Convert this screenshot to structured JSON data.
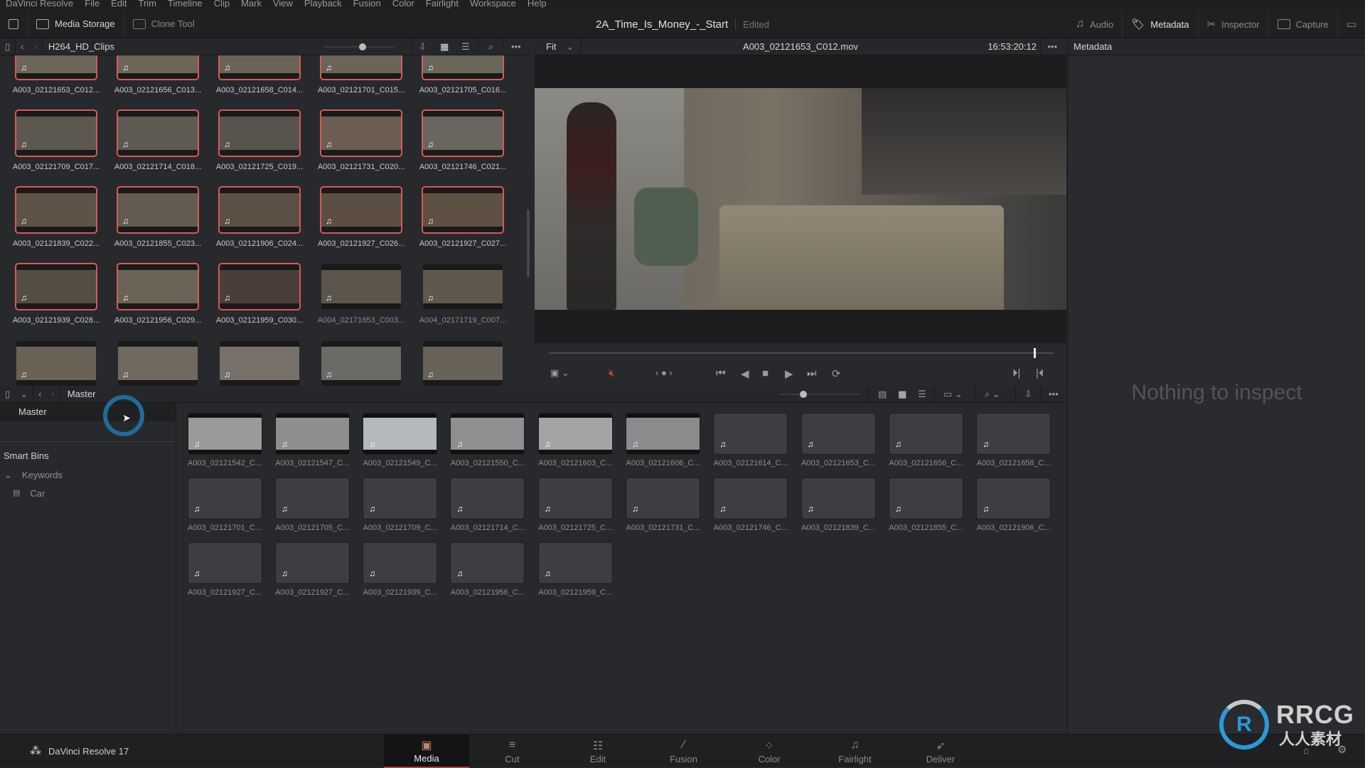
{
  "menubar": {
    "items": [
      "DaVinci Resolve",
      "File",
      "Edit",
      "Trim",
      "Timeline",
      "Clip",
      "Mark",
      "View",
      "Playback",
      "Fusion",
      "Color",
      "Fairlight",
      "Workspace",
      "Help"
    ]
  },
  "toolbar": {
    "media_storage": "Media Storage",
    "clone_tool": "Clone Tool",
    "project_title": "2A_Time_Is_Money_-_Start",
    "project_status": "Edited",
    "audio": "Audio",
    "metadata": "Metadata",
    "inspector": "Inspector",
    "capture": "Capture"
  },
  "upper_pool": {
    "bin_name": "H264_HD_Clips",
    "zoom_slider": 0.55,
    "clips": [
      {
        "name": "A003_02121653_C012...",
        "selected": true,
        "tint": "#6b655a"
      },
      {
        "name": "A003_02121656_C013...",
        "selected": true,
        "tint": "#6d6657"
      },
      {
        "name": "A003_02121658_C014...",
        "selected": true,
        "tint": "#6a6456"
      },
      {
        "name": "A003_02121701_C015...",
        "selected": true,
        "tint": "#6b6558"
      },
      {
        "name": "A003_02121705_C016...",
        "selected": true,
        "tint": "#6a665a"
      },
      {
        "name": "A003_02121709_C017...",
        "selected": true,
        "tint": "#5c5850"
      },
      {
        "name": "A003_02121714_C018...",
        "selected": true,
        "tint": "#5e5a51"
      },
      {
        "name": "A003_02121725_C019...",
        "selected": true,
        "tint": "#57534d"
      },
      {
        "name": "A003_02121731_C020...",
        "selected": true,
        "tint": "#6b5d52"
      },
      {
        "name": "A003_02121746_C021...",
        "selected": true,
        "tint": "#69655f"
      },
      {
        "name": "A003_02121839_C022...",
        "selected": true,
        "tint": "#5d5446"
      },
      {
        "name": "A003_02121855_C023...",
        "selected": true,
        "tint": "#615b50"
      },
      {
        "name": "A003_02121906_C024...",
        "selected": true,
        "tint": "#5b5044"
      },
      {
        "name": "A003_02121927_C026...",
        "selected": true,
        "tint": "#5c4f42"
      },
      {
        "name": "A003_02121927_C027...",
        "selected": true,
        "tint": "#5e5043"
      },
      {
        "name": "A003_02121939_C028...",
        "selected": true,
        "tint": "#544d42"
      },
      {
        "name": "A003_02121956_C029...",
        "selected": true,
        "tint": "#6a6356"
      },
      {
        "name": "A003_02121959_C030...",
        "selected": true,
        "tint": "#4a3e38"
      },
      {
        "name": "A004_02171653_C003...",
        "selected": false,
        "tint": "#5b554c"
      },
      {
        "name": "A004_02171719_C007...",
        "selected": false,
        "tint": "#5f574b"
      },
      {
        "name": "",
        "selected": false,
        "tint": "#6a6355"
      },
      {
        "name": "",
        "selected": false,
        "tint": "#706a5e"
      },
      {
        "name": "",
        "selected": false,
        "tint": "#77716a"
      },
      {
        "name": "",
        "selected": false,
        "tint": "#6a6a66"
      },
      {
        "name": "",
        "selected": false,
        "tint": "#686259"
      }
    ]
  },
  "viewer": {
    "fit": "Fit",
    "clip_name": "A003_02121653_C012.mov",
    "timecode": "16:53:20:12",
    "playhead": 0.96
  },
  "lower_pool": {
    "bin_name": "Master",
    "zoom_slider": 0.3,
    "clips": [
      {
        "name": "A003_02121542_C...",
        "thumb": true,
        "tint": "#9a9a98"
      },
      {
        "name": "A003_02121547_C...",
        "thumb": true,
        "tint": "#8d8f8f"
      },
      {
        "name": "A003_02121549_C...",
        "thumb": true,
        "tint": "#b3b9bc"
      },
      {
        "name": "A003_02121550_C...",
        "thumb": true,
        "tint": "#8e8f90"
      },
      {
        "name": "A003_02121603_C...",
        "thumb": true,
        "tint": "#a3a4a3"
      },
      {
        "name": "A003_02121606_C...",
        "thumb": true,
        "tint": "#8a8b8c"
      },
      {
        "name": "A003_02121614_C...",
        "thumb": false
      },
      {
        "name": "A003_02121653_C...",
        "thumb": false
      },
      {
        "name": "A003_02121656_C...",
        "thumb": false
      },
      {
        "name": "A003_02121658_C...",
        "thumb": false
      },
      {
        "name": "A003_02121701_C...",
        "thumb": false
      },
      {
        "name": "A003_02121705_C...",
        "thumb": false
      },
      {
        "name": "A003_02121709_C...",
        "thumb": false
      },
      {
        "name": "A003_02121714_C...",
        "thumb": false
      },
      {
        "name": "A003_02121725_C...",
        "thumb": false
      },
      {
        "name": "A003_02121731_C...",
        "thumb": false
      },
      {
        "name": "A003_02121746_C...",
        "thumb": false
      },
      {
        "name": "A003_02121839_C...",
        "thumb": false
      },
      {
        "name": "A003_02121855_C...",
        "thumb": false
      },
      {
        "name": "A003_02121906_C...",
        "thumb": false
      },
      {
        "name": "A003_02121927_C...",
        "thumb": false
      },
      {
        "name": "A003_02121927_C...",
        "thumb": false
      },
      {
        "name": "A003_02121939_C...",
        "thumb": false
      },
      {
        "name": "A003_02121956_C...",
        "thumb": false
      },
      {
        "name": "A003_02121959_C...",
        "thumb": false
      }
    ]
  },
  "bins": {
    "master": "Master",
    "smart_bins": "Smart Bins",
    "keywords": "Keywords",
    "car": "Car"
  },
  "inspector": {
    "header": "Metadata",
    "empty_message": "Nothing to inspect"
  },
  "bottom": {
    "app_name": "DaVinci Resolve 17",
    "pages": [
      {
        "label": "Media",
        "icon": "▣",
        "active": true
      },
      {
        "label": "Cut",
        "icon": "≡",
        "active": false
      },
      {
        "label": "Edit",
        "icon": "☷",
        "active": false
      },
      {
        "label": "Fusion",
        "icon": "⁄",
        "active": false
      },
      {
        "label": "Color",
        "icon": "⁘",
        "active": false
      },
      {
        "label": "Fairlight",
        "icon": "♫",
        "active": false
      },
      {
        "label": "Deliver",
        "icon": "➶",
        "active": false
      }
    ]
  },
  "watermark": {
    "line1": "RRCG",
    "line2": "人人素材"
  },
  "colors": {
    "accent_red": "#d65a55",
    "mute_red": "#c0443c",
    "cursor_ring": "#1f6c9a"
  }
}
